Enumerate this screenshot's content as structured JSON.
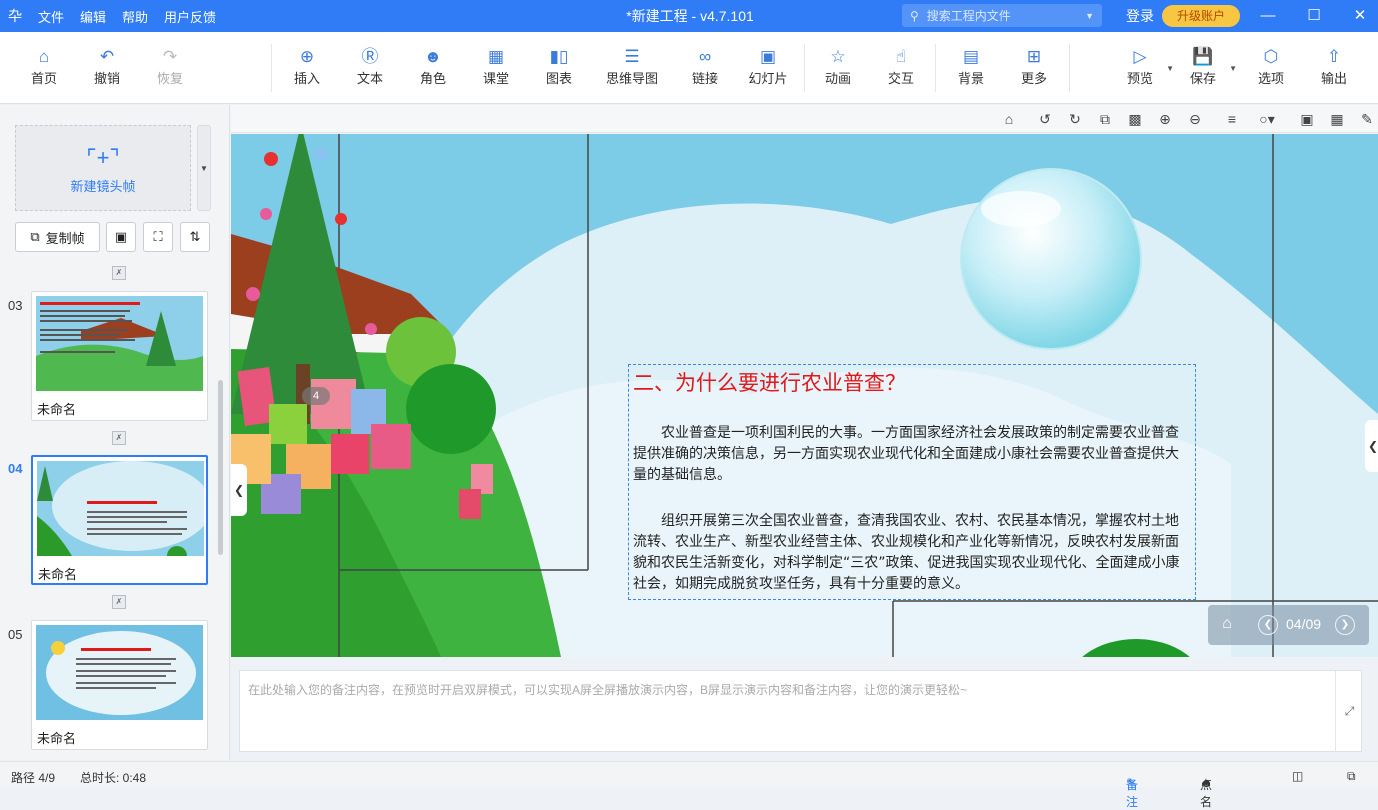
{
  "titlebar": {
    "logo": "卆",
    "menu": [
      "文件",
      "编辑",
      "帮助",
      "用户反馈"
    ],
    "title": "*新建工程 - v4.7.101",
    "search_placeholder": "搜索工程内文件",
    "login": "登录",
    "upgrade": "升级账户",
    "colors": {
      "bar": "#2f7cf6",
      "upgrade_bg": "#f7c744"
    }
  },
  "toolbar": {
    "home": "首页",
    "undo": "撤销",
    "redo": "恢复",
    "insert": "插入",
    "text": "文本",
    "role": "角色",
    "classroom": "课堂",
    "chart": "图表",
    "mindmap": "思维导图",
    "link": "链接",
    "slides": "幻灯片",
    "animation": "动画",
    "interact": "交互",
    "background": "背景",
    "more": "更多",
    "preview": "预览",
    "save": "保存",
    "options": "选项",
    "export": "输出"
  },
  "sidebar": {
    "new_frame": "新建镜头帧",
    "copy_frame": "复制帧",
    "frames": [
      {
        "num": "03",
        "name": "未命名",
        "active": false
      },
      {
        "num": "04",
        "name": "未命名",
        "active": true
      },
      {
        "num": "05",
        "name": "未命名",
        "active": false
      }
    ]
  },
  "slide": {
    "heading": "二、为什么要进行农业普查？",
    "para1": "农业普查是一项利国利民的大事。一方面国家经济社会发展政策的制定需要农业普查提供准确的决策信息，另一方面实现农业现代化和全面建成小康社会需要农业普查提供大量的基础信息。",
    "para2": "组织开展第三次全国农业普查，查清我国农业、农村、农民基本情况，掌握农村土地流转、农业生产、新型农业经营主体、农业规模化和产业化等新情况，反映农村发展新面貌和农民生活新变化，对科学制定“三农”政策、促进我国实现农业现代化、全面建成小康社会，如期完成脱贫攻坚任务，具有十分重要的意义。",
    "marker": "4",
    "pager": "04/09"
  },
  "notes": {
    "placeholder": "在此处输入您的备注内容，在预览时开启双屏模式，可以实现A屏全屏播放演示内容，B屏显示演示内容和备注内容，让您的演示更轻松~"
  },
  "status": {
    "path": "路径 4/9",
    "duration": "总时长: 0:48",
    "notes": "备注",
    "rollcall": "点名"
  }
}
